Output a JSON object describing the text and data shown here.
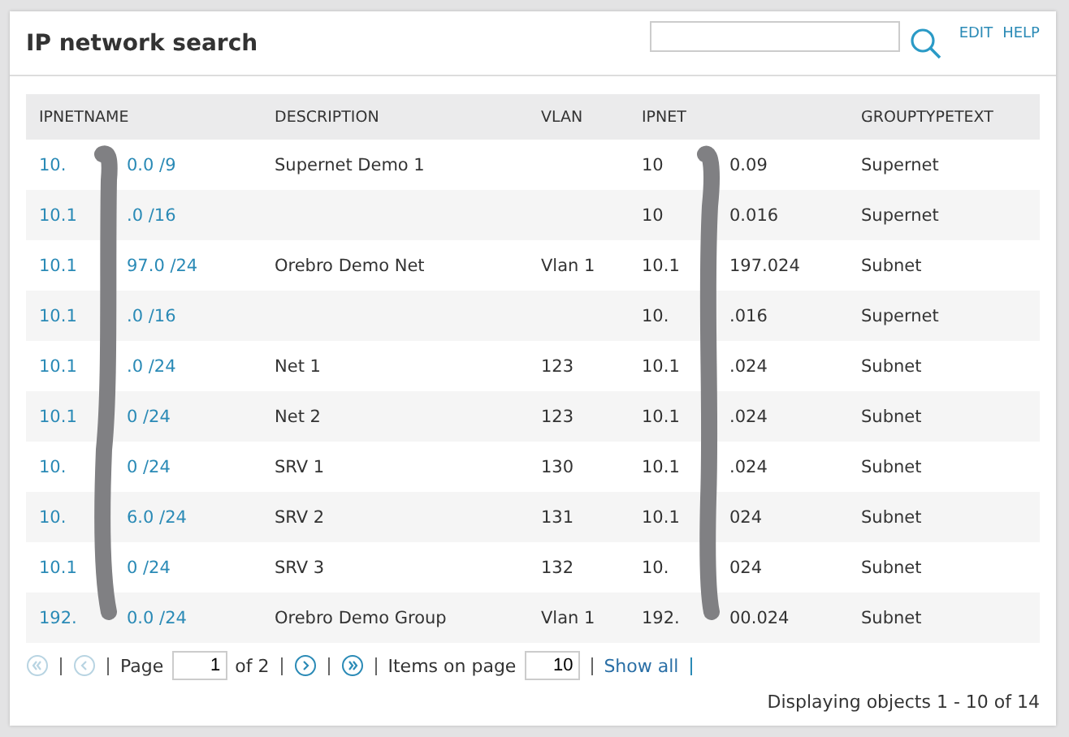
{
  "title": "IP network search",
  "header_links": [
    "EDIT",
    "HELP"
  ],
  "table": {
    "columns": [
      "IPNETNAME",
      "DESCRIPTION",
      "VLAN",
      "IPNET",
      "GROUPTYPETEXT"
    ],
    "rows": [
      {
        "ipnetname": [
          "10.",
          "0.0 /9"
        ],
        "description": "Supernet Demo 1",
        "vlan": "",
        "ipnet": [
          "10",
          "0.09"
        ],
        "grouptypetext": "Supernet"
      },
      {
        "ipnetname": [
          "10.1",
          ".0 /16"
        ],
        "description": "",
        "vlan": "",
        "ipnet": [
          "10",
          "0.016"
        ],
        "grouptypetext": "Supernet"
      },
      {
        "ipnetname": [
          "10.1",
          "97.0 /24"
        ],
        "description": "Orebro Demo Net",
        "vlan": "Vlan 1",
        "ipnet": [
          "10.1",
          "197.024"
        ],
        "grouptypetext": "Subnet"
      },
      {
        "ipnetname": [
          "10.1",
          ".0 /16"
        ],
        "description": "",
        "vlan": "",
        "ipnet": [
          "10.",
          ".016"
        ],
        "grouptypetext": "Supernet"
      },
      {
        "ipnetname": [
          "10.1",
          ".0 /24"
        ],
        "description": "Net 1",
        "vlan": "123",
        "ipnet": [
          "10.1",
          ".024"
        ],
        "grouptypetext": "Subnet"
      },
      {
        "ipnetname": [
          "10.1",
          "0 /24"
        ],
        "description": "Net 2",
        "vlan": "123",
        "ipnet": [
          "10.1",
          ".024"
        ],
        "grouptypetext": "Subnet"
      },
      {
        "ipnetname": [
          "10.",
          "0 /24"
        ],
        "description": "SRV 1",
        "vlan": "130",
        "ipnet": [
          "10.1",
          ".024"
        ],
        "grouptypetext": "Subnet"
      },
      {
        "ipnetname": [
          "10.",
          "6.0 /24"
        ],
        "description": "SRV 2",
        "vlan": "131",
        "ipnet": [
          "10.1",
          "024"
        ],
        "grouptypetext": "Subnet"
      },
      {
        "ipnetname": [
          "10.1",
          "0 /24"
        ],
        "description": "SRV 3",
        "vlan": "132",
        "ipnet": [
          "10.",
          "024"
        ],
        "grouptypetext": "Subnet"
      },
      {
        "ipnetname": [
          "192.",
          "0.0 /24"
        ],
        "description": "Orebro Demo Group",
        "vlan": "Vlan 1",
        "ipnet": [
          "192.",
          "00.024"
        ],
        "grouptypetext": "Subnet"
      }
    ]
  },
  "pager": {
    "first": {
      "disabled": true
    },
    "prev": {
      "disabled": true
    },
    "page_label": "Page",
    "page": "1",
    "of": "of 2",
    "next": {
      "disabled": false
    },
    "last": {
      "disabled": false
    },
    "items_label": "Items on page",
    "items": "10",
    "show_all": "Show all"
  },
  "status": "Displaying objects 1 - 10 of 14"
}
